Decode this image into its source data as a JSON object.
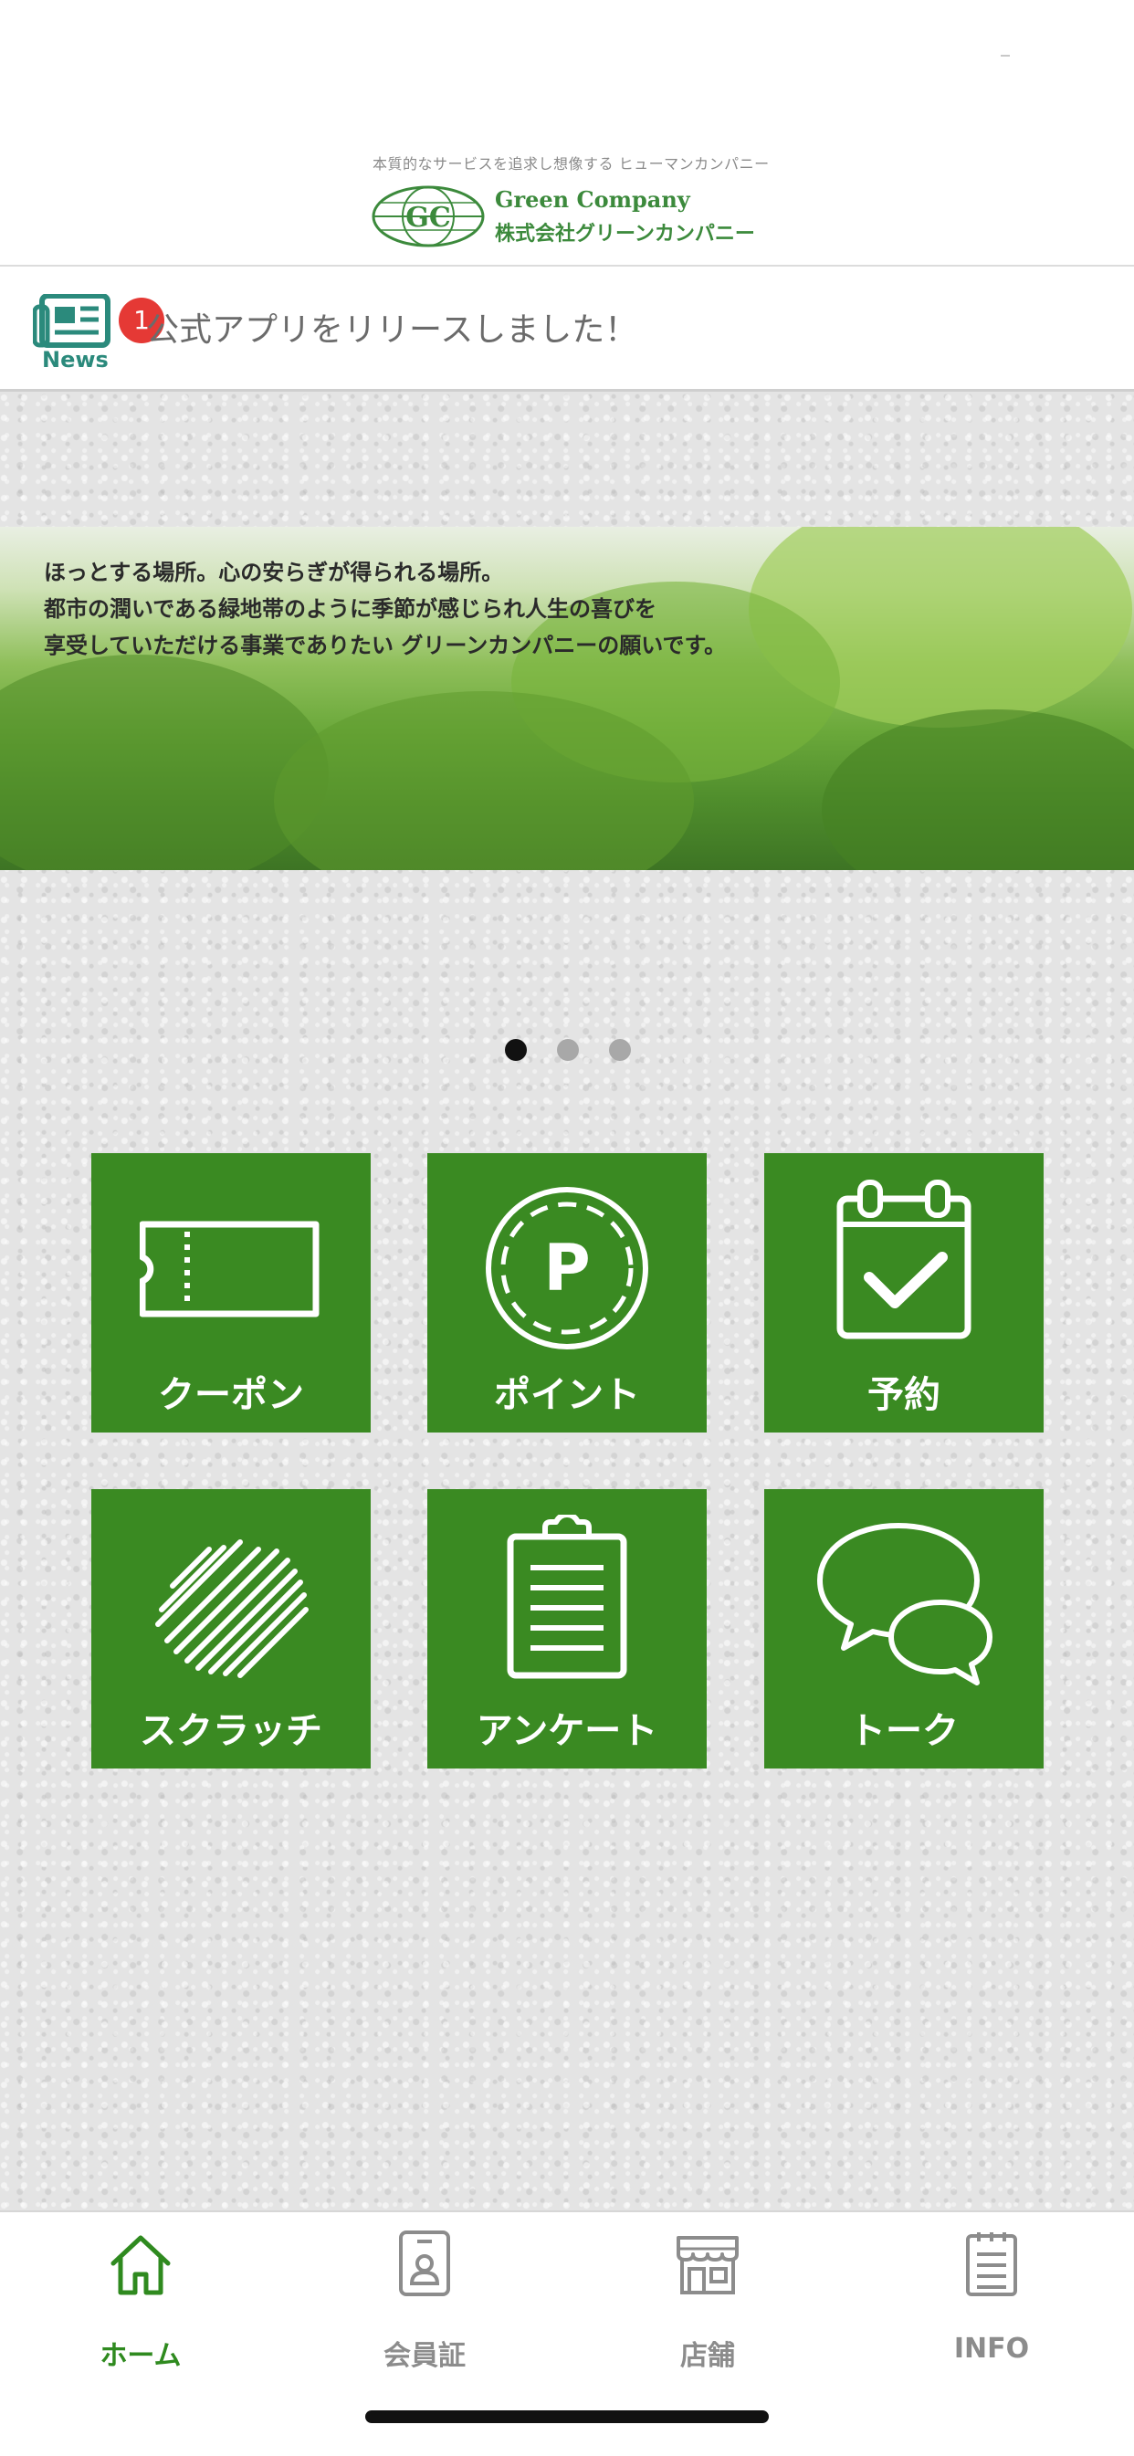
{
  "header": {
    "tagline": "本質的なサービスを追求し想像する ヒューマンカンパニー",
    "logo_mark": "GC",
    "company_en": "Green Company",
    "company_ja": "株式会社グリーンカンパニー"
  },
  "news": {
    "icon": "newspaper-icon",
    "label": "News",
    "badge_count": "1",
    "headline": "公式アプリをリリースしました！"
  },
  "banner": {
    "lines": [
      "ほっとする場所。心の安らぎが得られる場所。",
      "都市の潤いである緑地帯のように季節が感じられ人生の喜びを",
      "享受していただける事業でありたい グリーンカンパニーの願いです。"
    ],
    "slide_count": 3,
    "active_slide": 1
  },
  "menu": {
    "accent_color": "#3a8a22",
    "tiles": [
      {
        "label": "クーポン",
        "icon": "ticket-icon"
      },
      {
        "label": "ポイント",
        "icon": "point-coin-icon"
      },
      {
        "label": "予約",
        "icon": "calendar-check-icon"
      },
      {
        "label": "スクラッチ",
        "icon": "scratch-icon"
      },
      {
        "label": "アンケート",
        "icon": "clipboard-icon"
      },
      {
        "label": "トーク",
        "icon": "chat-bubbles-icon"
      }
    ]
  },
  "tabbar": {
    "active_color": "#2f8a1f",
    "items": [
      {
        "label": "ホーム",
        "icon": "home-icon",
        "active": true
      },
      {
        "label": "会員証",
        "icon": "member-card-icon",
        "active": false
      },
      {
        "label": "店舗",
        "icon": "store-icon",
        "active": false
      },
      {
        "label": "INFO",
        "icon": "info-list-icon",
        "active": false
      }
    ]
  }
}
